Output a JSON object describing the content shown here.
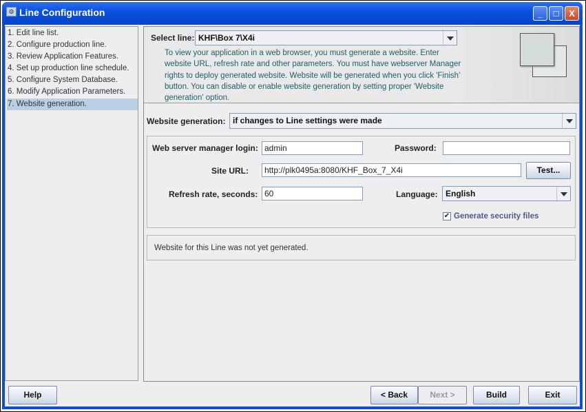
{
  "window": {
    "title": "Line Configuration",
    "min": "_",
    "max": "□",
    "close": "X"
  },
  "steps": [
    "1. Edit line list.",
    "2. Configure production line.",
    "3. Review Application Features.",
    "4. Set up production line schedule.",
    "5. Configure System Database.",
    "6. Modify Application Parameters.",
    "7. Website generation."
  ],
  "selected_step": 6,
  "header": {
    "select_line_label": "Select line:",
    "select_line_value": "KHF\\Box 7\\X4i",
    "description": "To view your application in a web browser, you must generate a website. Enter website URL, refresh rate and other parameters. You must have webserver Manager rights to deploy generated website. Website will be generated when you click 'Finish' button. You can disable or enable website generation by setting proper 'Website generation' option."
  },
  "form": {
    "website_generation_label": "Website generation:",
    "website_generation_value": "if changes to Line settings were made",
    "login_label": "Web server manager login:",
    "login_value": "admin",
    "password_label": "Password:",
    "password_value": "",
    "site_url_label": "Site URL:",
    "site_url_value": "http://plk0495a:8080/KHF_Box_7_X4i",
    "test_button": "Test...",
    "refresh_label": "Refresh rate, seconds:",
    "refresh_value": "60",
    "language_label": "Language:",
    "language_value": "English",
    "security_label": "Generate security files",
    "security_checked": true
  },
  "status": "Website for this Line was not yet generated.",
  "buttons": {
    "help": "Help",
    "back": "< Back",
    "next": "Next >",
    "build": "Build",
    "exit": "Exit"
  }
}
